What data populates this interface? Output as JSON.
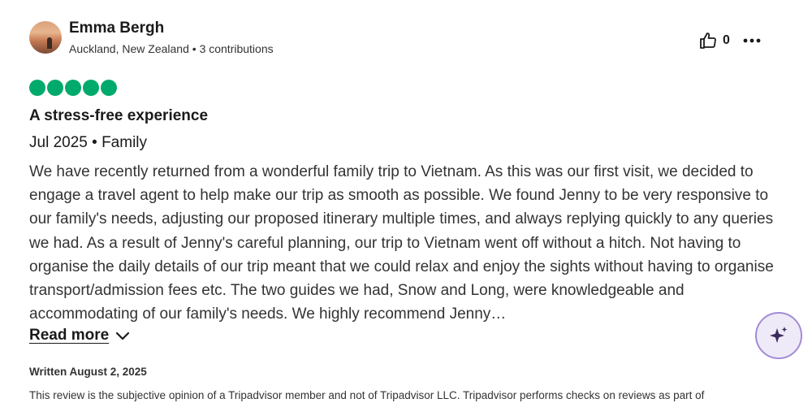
{
  "reviewer": {
    "name": "Emma Bergh",
    "location": "Auckland, New Zealand",
    "contributions": "3 contributions"
  },
  "helpful": {
    "count": "0"
  },
  "rating": {
    "value": 5,
    "max": 5,
    "color": "#00aa6c"
  },
  "review": {
    "title": "A stress-free experience",
    "date": "Jul 2025",
    "trip_type": "Family",
    "text": "We have recently returned from a wonderful family trip to Vietnam. As this was our first visit, we decided to engage a travel agent to help make our trip as smooth as possible. We found Jenny to be very responsive to our family's needs, adjusting our proposed itinerary multiple times, and always replying quickly to any queries we had. As a result of Jenny's careful planning, our trip to Vietnam went off without a hitch. Not having to organise the daily details of our trip meant that we could relax and enjoy the sights without having to organise transport/admission fees etc. The two guides we had, Snow and Long, were knowledgeable and accommodating of our family's needs. We highly recommend Jenny…",
    "read_more": "Read more",
    "written": "Written August 2, 2025",
    "disclaimer": "This review is the subjective opinion of a Tripadvisor member and not of Tripadvisor LLC. Tripadvisor performs checks on reviews as part of"
  },
  "icons": {
    "helpful": "thumbs-up-icon",
    "more": "more-options-icon",
    "read_more": "chevron-down-icon",
    "ai": "ai-sparkle-icon"
  }
}
